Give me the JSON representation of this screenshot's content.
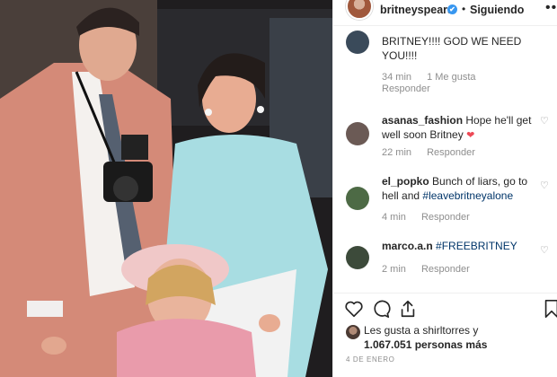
{
  "header": {
    "username": "britneyspears",
    "verified_glyph": "✔",
    "separator": "•",
    "follow_status": "Siguiendo",
    "more_glyph": "•••"
  },
  "comments": [
    {
      "user": "",
      "text": "BRITNEY!!!! GOD WE NEED YOU!!!!",
      "time": "34 min",
      "likes": "1 Me gusta",
      "reply": "Responder",
      "avatar_color": "#3a4a5a"
    },
    {
      "user": "asanas_fashion",
      "text": "Hope he'll get well soon Britney",
      "emoji": "❤",
      "time": "22 min",
      "reply": "Responder",
      "avatar_color": "#6b5a55"
    },
    {
      "user": "el_popko",
      "text": "Bunch of liars, go to hell and",
      "hashtag": "#leavebritneyalone",
      "time": "4 min",
      "reply": "Responder",
      "avatar_color": "#4d6a45"
    },
    {
      "user": "marco.a.n",
      "text": "",
      "hashtag": "#FREEBRITNEY",
      "time": "2 min",
      "reply": "Responder",
      "avatar_color": "#3c4a3a"
    }
  ],
  "icons": {
    "like": "heart-outline-icon",
    "comment": "comment-bubble-icon",
    "share": "share-icon",
    "save": "bookmark-icon"
  },
  "likes": {
    "line1": "Les gusta a shirltorres y",
    "line2": "1.067.051 personas más"
  },
  "date": "4 DE ENERO",
  "colors": {
    "link": "#003569",
    "muted": "#8e8e8e",
    "verified": "#3897f0",
    "heart": "#ed4956"
  }
}
